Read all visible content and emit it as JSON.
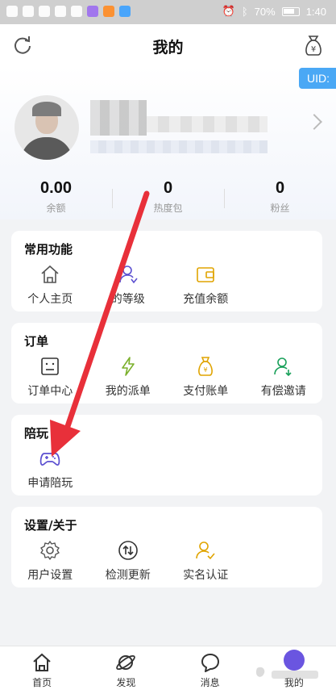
{
  "status_bar": {
    "battery": "70%",
    "time": "1:40"
  },
  "header": {
    "title": "我的",
    "refresh_icon": "refresh-icon",
    "wallet_icon": "wallet-yuan-icon"
  },
  "profile": {
    "uid_label": "UID:",
    "stats": [
      {
        "value": "0.00",
        "label": "余额"
      },
      {
        "value": "0",
        "label": "热度包"
      },
      {
        "value": "0",
        "label": "粉丝"
      }
    ]
  },
  "sections": {
    "common": {
      "title": "常用功能",
      "items": [
        {
          "label": "个人主页",
          "icon": "home-icon"
        },
        {
          "label": "的等级",
          "icon": "user-level-icon"
        },
        {
          "label": "充值余额",
          "icon": "wallet-icon"
        }
      ]
    },
    "orders": {
      "title": "订单",
      "items": [
        {
          "label": "订单中心",
          "icon": "order-list-icon"
        },
        {
          "label": "我的派单",
          "icon": "lightning-icon"
        },
        {
          "label": "支付账单",
          "icon": "money-bag-icon"
        },
        {
          "label": "有偿邀请",
          "icon": "invite-user-icon"
        }
      ]
    },
    "companion": {
      "title": "陪玩",
      "items": [
        {
          "label": "申请陪玩",
          "icon": "gamepad-icon"
        }
      ]
    },
    "settings": {
      "title": "设置/关于",
      "items": [
        {
          "label": "用户设置",
          "icon": "gear-icon"
        },
        {
          "label": "检测更新",
          "icon": "update-arrows-icon"
        },
        {
          "label": "实名认证",
          "icon": "verified-user-icon"
        }
      ]
    }
  },
  "tabbar": {
    "items": [
      {
        "label": "首页",
        "icon": "home-tab-icon"
      },
      {
        "label": "发现",
        "icon": "planet-icon"
      },
      {
        "label": "消息",
        "icon": "chat-icon"
      },
      {
        "label": "我的",
        "icon": "profile-tab-icon"
      }
    ]
  },
  "colors": {
    "accent_yellow": "#e0a400",
    "accent_purple": "#5b4fd0",
    "accent_blue": "#4aa8f5",
    "accent_green": "#19a05a",
    "arrow_red": "#e8303a"
  }
}
